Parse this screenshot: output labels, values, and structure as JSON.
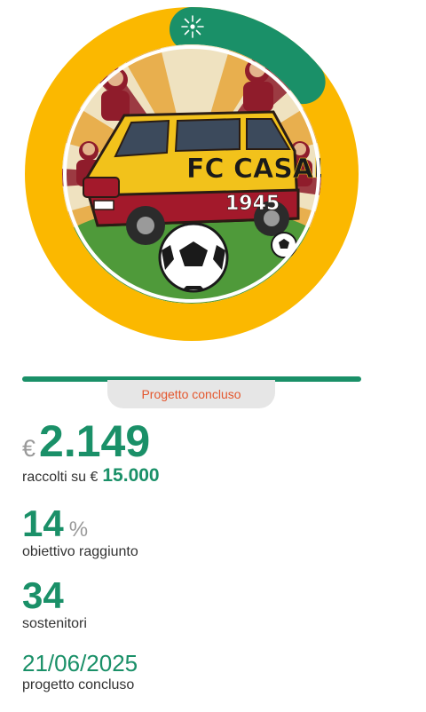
{
  "campaign": {
    "status_label": "Progetto concluso",
    "currency_symbol": "€",
    "amount_raised": "2.149",
    "raised_prefix": "raccolti su €",
    "goal_amount": "15.000",
    "percent_value": "14",
    "percent_symbol": "%",
    "percent_label": "obiettivo raggiunto",
    "backers_count": "34",
    "backers_label": "sostenitori",
    "end_date": "21/06/2025",
    "end_label": "progetto concluso",
    "progress_fraction": 0.14
  },
  "emblem": {
    "text_line1": "FC CASALE",
    "text_line2": "1945"
  },
  "colors": {
    "ring_track": "#fbb800",
    "ring_progress": "#1a9068",
    "accent": "#1a9068",
    "status_text": "#e4572e"
  },
  "icons": {
    "ring_marker": "burst-icon"
  }
}
